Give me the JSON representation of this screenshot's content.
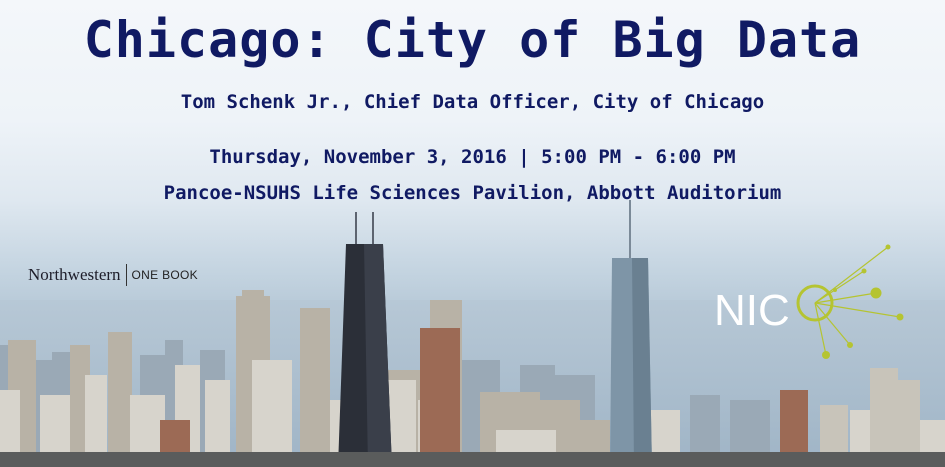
{
  "title": "Chicago: City of Big Data",
  "speaker": "Tom Schenk Jr., Chief Data Officer, City of Chicago",
  "datetime": "Thursday, November 3, 2016 | 5:00 PM - 6:00 PM",
  "venue": "Pancoe-NSUHS Life Sciences Pavilion, Abbott Auditorium",
  "northwestern_logo": {
    "name": "Northwestern",
    "sub": "ONE BOOK"
  },
  "nico_logo": {
    "text": "NICO",
    "accent": "#b5c431"
  },
  "colors": {
    "title": "#101a63"
  }
}
